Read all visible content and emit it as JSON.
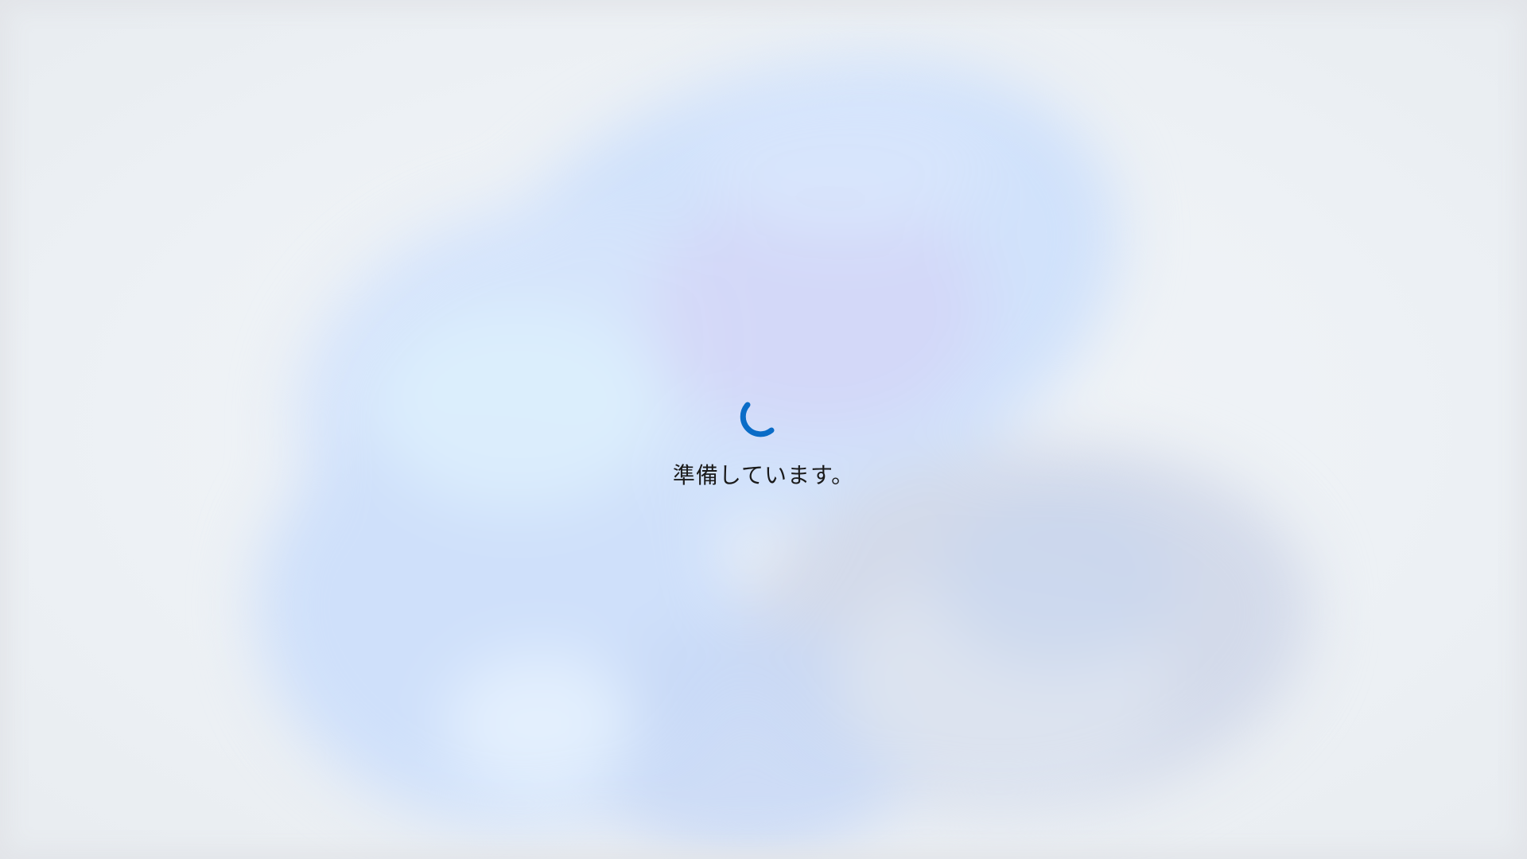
{
  "loading": {
    "status_text": "準備しています。",
    "spinner_icon": "loading-spinner-icon",
    "spinner_color": "#0a6cc7"
  },
  "background": {
    "base_color": "#eef1f5",
    "accent_color": "#cfe0fb"
  }
}
